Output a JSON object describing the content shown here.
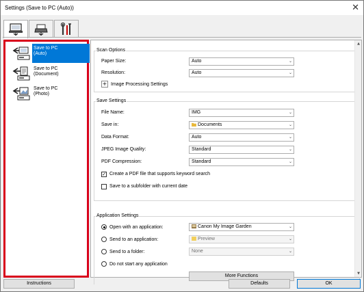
{
  "window": {
    "title": "Settings (Save to PC (Auto))",
    "close_glyph": "✕"
  },
  "tabs": [
    {
      "name": "scan-from-computer",
      "icon": "computer-scan-icon"
    },
    {
      "name": "scan-from-operation-panel",
      "icon": "scanner-panel-icon"
    },
    {
      "name": "general-settings",
      "icon": "tools-icon"
    }
  ],
  "sidebar": {
    "items": [
      {
        "label_l1": "Save to PC",
        "label_l2": "(Auto)",
        "selected": true,
        "icon": "save-auto-icon"
      },
      {
        "label_l1": "Save to PC",
        "label_l2": "(Document)",
        "selected": false,
        "icon": "save-document-icon"
      },
      {
        "label_l1": "Save to PC",
        "label_l2": "(Photo)",
        "selected": false,
        "icon": "save-photo-icon"
      }
    ]
  },
  "scan_options": {
    "title": "Scan Options",
    "paper_size": {
      "label": "Paper Size:",
      "value": "Auto"
    },
    "resolution": {
      "label": "Resolution:",
      "value": "Auto"
    },
    "image_processing": {
      "label": "Image Processing Settings",
      "glyph": "+"
    }
  },
  "save_settings": {
    "title": "Save Settings",
    "file_name": {
      "label": "File Name:",
      "value": "IMG"
    },
    "save_in": {
      "label": "Save in:",
      "value": "Documents"
    },
    "data_format": {
      "label": "Data Format:",
      "value": "Auto"
    },
    "jpeg_quality": {
      "label": "JPEG Image Quality:",
      "value": "Standard"
    },
    "pdf_compression": {
      "label": "PDF Compression:",
      "value": "Standard"
    },
    "keyword_pdf": {
      "label": "Create a PDF file that supports keyword search",
      "checked": true
    },
    "subfolder": {
      "label": "Save to a subfolder with current date",
      "checked": false
    }
  },
  "app_settings": {
    "title": "Application Settings",
    "open_with": {
      "label": "Open with an application:",
      "value": "Canon My Image Garden",
      "checked": true
    },
    "send_to_app": {
      "label": "Send to an application:",
      "value": "Preview",
      "checked": false
    },
    "send_to_folder": {
      "label": "Send to a folder:",
      "value": "None",
      "checked": false
    },
    "do_not_start": {
      "label": "Do not start any application",
      "checked": false
    },
    "more_functions": "More Functions"
  },
  "footer": {
    "instructions": "Instructions",
    "defaults": "Defaults",
    "ok": "OK"
  },
  "glyphs": {
    "dropdown_arrow": "⌄",
    "check": "✓",
    "scroll_up": "▲",
    "scroll_down": "▼"
  },
  "colors": {
    "selection": "#0078d7",
    "highlight_border": "#d9001b"
  }
}
